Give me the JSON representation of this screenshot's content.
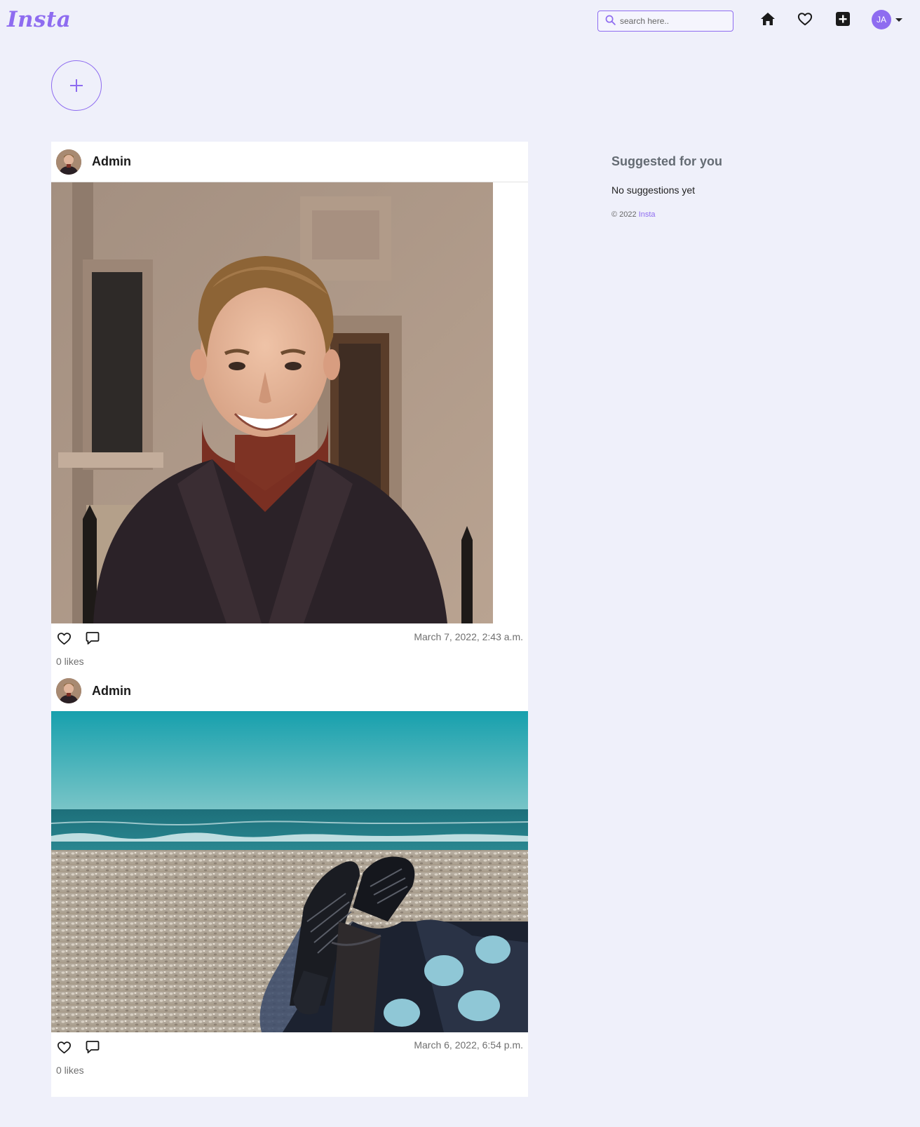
{
  "navbar": {
    "brand": "Insta",
    "search_placeholder": "search here..",
    "icons": [
      "search-icon",
      "home-icon",
      "heart-icon",
      "plus-square-icon",
      "caret-down-icon"
    ],
    "user_initials": "JA"
  },
  "stories": {
    "add_icon": "plus-icon"
  },
  "posts": [
    {
      "username": "Admin",
      "image": "portrait-man-smiling",
      "date": "March 7, 2022, 2:43 a.m.",
      "likes": "0 likes"
    },
    {
      "username": "Admin",
      "image": "beach-boots",
      "date": "March 6, 2022, 6:54 p.m.",
      "likes": "0 likes"
    }
  ],
  "sidebar": {
    "title": "Suggested for you",
    "empty": "No suggestions yet",
    "copyright": "© 2022",
    "brand_link": "Insta"
  },
  "colors": {
    "accent": "#8e6cf0",
    "background": "#eff0fa"
  }
}
